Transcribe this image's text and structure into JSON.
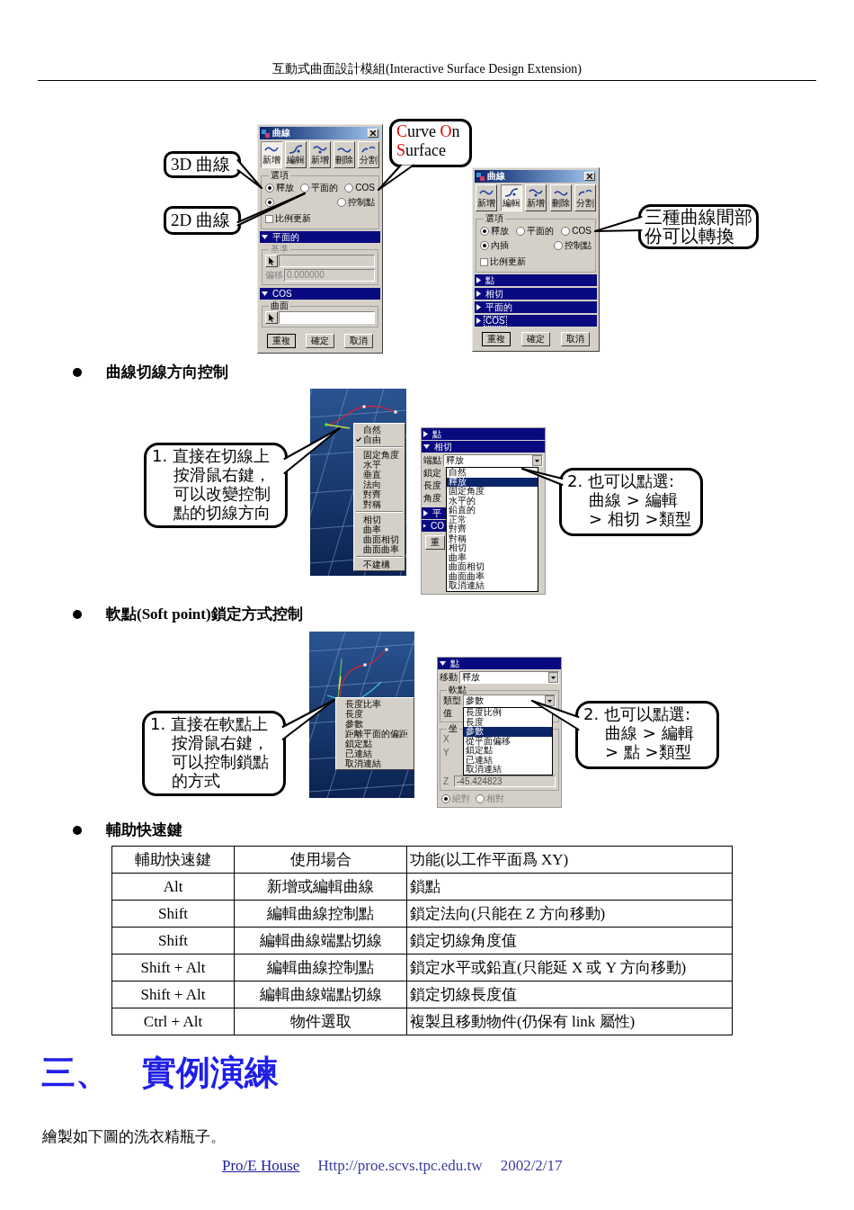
{
  "header": {
    "title": "互動式曲面設計模組(Interactive Surface Design Extension)"
  },
  "figure_1": {
    "dialogs": [
      {
        "title": "曲線",
        "tools": [
          {
            "label": "新增",
            "selected": true
          },
          {
            "label": "編輯",
            "selected": false
          },
          {
            "label": "新增",
            "selected": false
          },
          {
            "label": "刪除",
            "selected": false
          },
          {
            "label": "分割",
            "selected": false
          }
        ],
        "options": {
          "legend": "選項",
          "types": [
            {
              "label": "釋放",
              "selected": true
            },
            {
              "label": "平面的",
              "selected": false
            },
            {
              "label": "COS",
              "selected": false
            }
          ],
          "modes": [
            {
              "selected": true
            },
            {
              "label": "控制點",
              "selected": false
            }
          ],
          "checkbox": {
            "label": "比例更新",
            "checked": false
          }
        },
        "sections": [
          {
            "title": "平面的",
            "expanded": true,
            "kind": "planar",
            "disabled": true,
            "group": "基準",
            "offset_label": "偏移",
            "offset_value": "0.000000"
          },
          {
            "title": "COS",
            "expanded": true,
            "kind": "surface",
            "disabled": false,
            "group": "曲面"
          }
        ],
        "buttons": [
          {
            "label": "重複",
            "default": true
          },
          {
            "label": "確定",
            "default": false
          },
          {
            "label": "取消",
            "default": false
          }
        ]
      },
      {
        "title": "曲線",
        "tools": [
          {
            "label": "新增",
            "selected": false
          },
          {
            "label": "編輯",
            "selected": true
          },
          {
            "label": "新增",
            "selected": false
          },
          {
            "label": "刪除",
            "selected": false
          },
          {
            "label": "分割",
            "selected": false
          }
        ],
        "options": {
          "legend": "選項",
          "types": [
            {
              "label": "釋放",
              "selected": true
            },
            {
              "label": "平面的",
              "selected": false
            },
            {
              "label": "COS",
              "selected": false
            }
          ],
          "modes": [
            {
              "label": "內插",
              "selected": true
            },
            {
              "label": "控制點",
              "selected": false
            }
          ],
          "checkbox": {
            "label": "比例更新",
            "checked": false
          }
        },
        "sections": [
          {
            "title": "點",
            "expanded": false,
            "focused": false
          },
          {
            "title": "相切",
            "expanded": false,
            "focused": false
          },
          {
            "title": "平面的",
            "expanded": false,
            "focused": false
          },
          {
            "title": "COS",
            "expanded": false,
            "focused": true
          }
        ],
        "buttons": [
          {
            "label": "重複",
            "default": true
          },
          {
            "label": "確定",
            "default": false
          },
          {
            "label": "取消",
            "default": false
          }
        ]
      }
    ],
    "callouts": [
      {
        "kind": "plain",
        "lines": [
          "3D 曲線"
        ]
      },
      {
        "kind": "plain",
        "lines": [
          "2D 曲線"
        ]
      },
      {
        "kind": "initials",
        "parts": [
          {
            "text": "C",
            "highlight": true
          },
          {
            "text": "urve ",
            "highlight": false
          },
          {
            "text": "O",
            "highlight": true
          },
          {
            "text": "n ",
            "highlight": false
          },
          {
            "text": "S",
            "highlight": true
          },
          {
            "text": "urface",
            "highlight": false
          }
        ]
      },
      {
        "kind": "plain",
        "lines": [
          "三種曲線間部",
          "份可以轉換"
        ]
      }
    ]
  },
  "section_1": {
    "heading": "曲線切線方向控制",
    "figure": {
      "menu": [
        {
          "kind": "item",
          "label": "自然",
          "checked": false
        },
        {
          "kind": "item",
          "label": "自由",
          "checked": true
        },
        {
          "kind": "separator"
        },
        {
          "kind": "item",
          "label": "固定角度",
          "checked": false
        },
        {
          "kind": "item",
          "label": "水平",
          "checked": false
        },
        {
          "kind": "item",
          "label": "垂直",
          "checked": false
        },
        {
          "kind": "item",
          "label": "法向",
          "checked": false
        },
        {
          "kind": "item",
          "label": "對齊",
          "checked": false
        },
        {
          "kind": "item",
          "label": "對稱",
          "checked": false
        },
        {
          "kind": "separator"
        },
        {
          "kind": "item",
          "label": "相切",
          "checked": false
        },
        {
          "kind": "item",
          "label": "曲率",
          "checked": false
        },
        {
          "kind": "item",
          "label": "曲面相切",
          "checked": false
        },
        {
          "kind": "item",
          "label": "曲面曲率",
          "checked": false
        },
        {
          "kind": "separator"
        },
        {
          "kind": "item",
          "label": "不建構",
          "checked": false
        }
      ],
      "panel": {
        "sections": [
          {
            "title": "點",
            "expanded": false
          },
          {
            "title": "相切",
            "expanded": true
          }
        ],
        "combo": {
          "label": "端點",
          "value": "釋放"
        },
        "labels": [
          "鎖定",
          "長度",
          "角度"
        ],
        "sections_lower": [
          {
            "title": "平",
            "expanded": false
          },
          {
            "title": "CO",
            "expanded": false
          }
        ],
        "button": "重",
        "dropdown": [
          {
            "label": "自然",
            "selected": false
          },
          {
            "label": "釋放",
            "selected": true
          },
          {
            "label": "固定角度",
            "selected": false
          },
          {
            "label": "水平的",
            "selected": false
          },
          {
            "label": "鉛直的",
            "selected": false
          },
          {
            "label": "正常",
            "selected": false
          },
          {
            "label": "對齊",
            "selected": false
          },
          {
            "label": "對稱",
            "selected": false
          },
          {
            "label": "相切",
            "selected": false
          },
          {
            "label": "曲率",
            "selected": false
          },
          {
            "label": "曲面相切",
            "selected": false
          },
          {
            "label": "曲面曲率",
            "selected": false
          },
          {
            "label": "取消連結",
            "selected": false
          }
        ]
      },
      "callouts": [
        {
          "kind": "plain",
          "lines": [
            "1. 直接在切線上",
            "按滑鼠右鍵，",
            "可以改變控制",
            "點的切線方向"
          ]
        },
        {
          "kind": "plain",
          "lines": [
            "2.  也可以點選:",
            "曲線 > 編輯",
            "> 相切 >類型"
          ]
        }
      ]
    }
  },
  "section_2": {
    "heading": "軟點(Soft point)鎖定方式控制",
    "figure": {
      "menu": [
        {
          "kind": "item",
          "label": "長度比率"
        },
        {
          "kind": "item",
          "label": "長度"
        },
        {
          "kind": "item",
          "label": "參數"
        },
        {
          "kind": "item",
          "label": "距離平面的偏距"
        },
        {
          "kind": "item",
          "label": "鎖定點"
        },
        {
          "kind": "item",
          "label": "已連結"
        },
        {
          "kind": "item",
          "label": "取消連結"
        }
      ],
      "panel": {
        "section": {
          "title": "點",
          "expanded": true
        },
        "move": {
          "label": "移動",
          "value": "釋放"
        },
        "soft_point": {
          "legend": "軟點",
          "type": {
            "label": "類型",
            "value": "參數"
          },
          "value_label": "值",
          "dropdown": [
            {
              "label": "長度比例",
              "selected": false
            },
            {
              "label": "長度",
              "selected": false
            },
            {
              "label": "參數",
              "selected": true
            },
            {
              "label": "從平面偏移",
              "selected": false
            },
            {
              "label": "鎖定點",
              "selected": false
            },
            {
              "label": "已連結",
              "selected": false
            },
            {
              "label": "取消連結",
              "selected": false
            }
          ]
        },
        "coordinates": {
          "legend": "坐",
          "axes": [
            {
              "label": "X"
            },
            {
              "label": "Y"
            },
            {
              "label": "Z",
              "value": "-45.424823"
            }
          ]
        },
        "reference": [
          {
            "label": "絕對",
            "selected": true
          },
          {
            "label": "相對",
            "selected": false
          }
        ]
      },
      "callouts": [
        {
          "kind": "plain",
          "lines": [
            "1. 直接在軟點上",
            "按滑鼠右鍵，",
            "可以控制鎖點",
            "的方式"
          ]
        },
        {
          "kind": "plain",
          "lines": [
            "2.  也可以點選:",
            "曲線 > 編輯",
            "> 點 >類型"
          ]
        }
      ]
    }
  },
  "section_3": {
    "heading": "輔助快速鍵",
    "table": {
      "columns": [
        "輔助快速鍵",
        "使用場合",
        "功能(以工作平面爲 XY)"
      ],
      "rows": [
        [
          "Alt",
          "新增或編輯曲線",
          "鎖點"
        ],
        [
          "Shift",
          "編輯曲線控制點",
          "鎖定法向(只能在 Z 方向移動)"
        ],
        [
          "Shift",
          "編輯曲線端點切線",
          "鎖定切線角度值"
        ],
        [
          "Shift + Alt",
          "編輯曲線控制點",
          "鎖定水平或鉛直(只能延 X 或 Y 方向移動)"
        ],
        [
          "Shift + Alt",
          "編輯曲線端點切線",
          "鎖定切線長度值"
        ],
        [
          "Ctrl + Alt",
          "物件選取",
          "複製且移動物件(仍保有 link 屬性)"
        ]
      ]
    }
  },
  "chapter": {
    "number": "三、",
    "title": "實例演練",
    "text": "繪製如下圖的洗衣精瓶子。"
  },
  "footer": {
    "link": "Pro/E House",
    "url": "Http://proe.scvs.tpc.edu.tw",
    "date": "2002/2/17"
  }
}
